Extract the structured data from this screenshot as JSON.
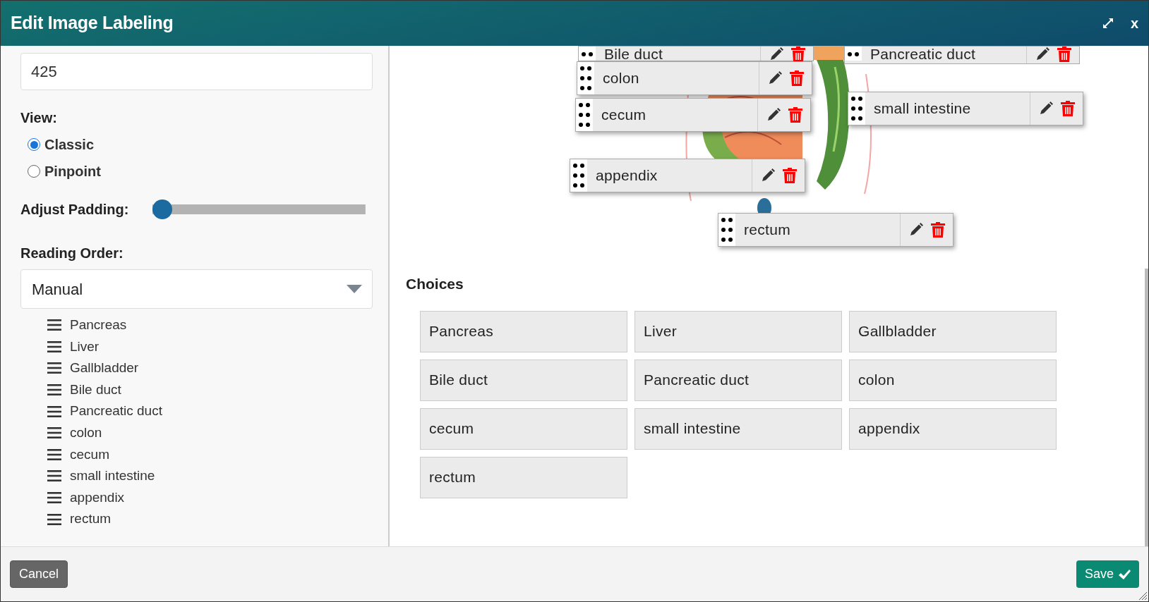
{
  "window": {
    "title": "Edit Image Labeling",
    "close": "x"
  },
  "settings": {
    "value_field": "425",
    "view_label": "View:",
    "view_options": [
      {
        "label": "Classic",
        "selected": true
      },
      {
        "label": "Pinpoint",
        "selected": false
      }
    ],
    "padding_label": "Adjust Padding:",
    "padding": {
      "level": 0
    },
    "reading_order_label": "Reading Order:",
    "reading_order": "Manual",
    "order_items": [
      "Pancreas",
      "Liver",
      "Gallbladder",
      "Bile duct",
      "Pancreatic duct",
      "colon",
      "cecum",
      "small intestine",
      "appendix",
      "rectum"
    ]
  },
  "canvas": {
    "labels": [
      {
        "text": "Bile duct"
      },
      {
        "text": "Pancreatic duct"
      },
      {
        "text": "colon"
      },
      {
        "text": "cecum"
      },
      {
        "text": "small intestine"
      },
      {
        "text": "appendix"
      },
      {
        "text": "rectum"
      }
    ]
  },
  "choices": {
    "title": "Choices",
    "items": [
      "Pancreas",
      "Liver",
      "Gallbladder",
      "Bile duct",
      "Pancreatic duct",
      "colon",
      "cecum",
      "small intestine",
      "appendix",
      "rectum"
    ]
  },
  "footer": {
    "cancel": "Cancel",
    "save": "Save"
  }
}
